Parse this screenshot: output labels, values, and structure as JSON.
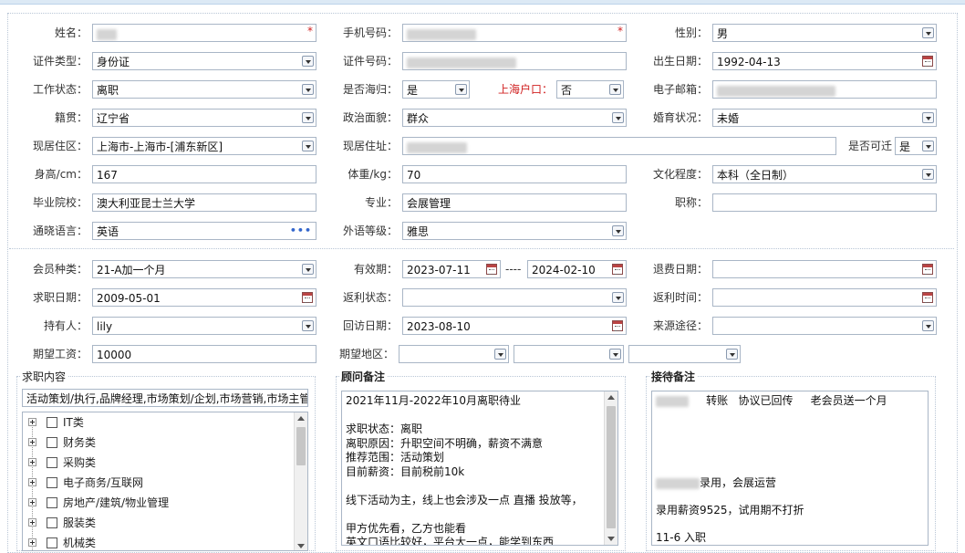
{
  "section1": {
    "row1": {
      "name_label": "姓名：",
      "phone_label": "手机号码：",
      "gender_label": "性别：",
      "gender_value": "男"
    },
    "row2": {
      "id_type_label": "证件类型：",
      "id_type_value": "身份证",
      "id_no_label": "证件号码：",
      "birth_label": "出生日期：",
      "birth_value": "1992-04-13"
    },
    "row3": {
      "work_status_label": "工作状态：",
      "work_status_value": "离职",
      "overseas_label": "是否海归：",
      "overseas_value": "是",
      "hukou_label": "上海户口：",
      "hukou_value": "否",
      "email_label": "电子邮箱："
    },
    "row4": {
      "native_label": "籍贯：",
      "native_value": "辽宁省",
      "political_label": "政治面貌：",
      "political_value": "群众",
      "marital_label": "婚育状况：",
      "marital_value": "未婚"
    },
    "row5": {
      "residence_label": "现居住区：",
      "residence_value": "上海市-上海市-[浦东新区]",
      "address_label": "现居住址：",
      "relocate_label": "是否可迁",
      "relocate_value": "是"
    },
    "row6": {
      "height_label": "身高/cm：",
      "height_value": "167",
      "weight_label": "体重/kg：",
      "weight_value": "70",
      "edu_label": "文化程度：",
      "edu_value": "本科（全日制）"
    },
    "row7": {
      "school_label": "毕业院校：",
      "school_value": "澳大利亚昆士兰大学",
      "major_label": "专业：",
      "major_value": "会展管理",
      "title_label": "职称：",
      "title_value": ""
    },
    "row8": {
      "lang_label": "通晓语言：",
      "lang_value": "英语",
      "lang_level_label": "外语等级：",
      "lang_level_value": "雅思"
    }
  },
  "section2": {
    "row1": {
      "member_type_label": "会员种类：",
      "member_type_value": "21-A加一个月",
      "valid_label": "有效期：",
      "valid_from": "2023-07-11",
      "valid_sep": "----",
      "valid_to": "2024-02-10",
      "refund_label": "退费日期："
    },
    "row2": {
      "job_date_label": "求职日期：",
      "job_date_value": "2009-05-01",
      "rebate_status_label": "返利状态：",
      "rebate_time_label": "返利时间："
    },
    "row3": {
      "holder_label": "持有人：",
      "holder_value": "lily",
      "visit_label": "回访日期：",
      "visit_value": "2023-08-10",
      "source_label": "来源途径："
    },
    "row4": {
      "salary_label": "期望工资：",
      "salary_value": "10000",
      "region_label": "期望地区："
    }
  },
  "job_content": {
    "title": "求职内容",
    "summary": "活动策划/执行,品牌经理,市场策划/企划,市场营销,市场主管",
    "tree": [
      {
        "label": "IT类"
      },
      {
        "label": "财务类"
      },
      {
        "label": "采购类"
      },
      {
        "label": "电子商务/互联网"
      },
      {
        "label": "房地产/建筑/物业管理"
      },
      {
        "label": "服装类"
      },
      {
        "label": "机械类"
      }
    ]
  },
  "advisor_notes": {
    "title": "顾问备注",
    "lines": [
      "2021年11月-2022年10月离职待业",
      "",
      "求职状态：离职",
      "离职原因：升职空间不明确，薪资不满意",
      "推荐范围：活动策划",
      "目前薪资：目前税前10k",
      "",
      "线下活动为主，线上也会涉及一点 直播 投放等，",
      "",
      "甲方优先看，乙方也能看",
      "英文口语比较好，平台大一点，能学到东西"
    ]
  },
  "reception_notes": {
    "title": "接待备注",
    "line1_a": "转账",
    "line1_b": "协议已回传",
    "line1_c": "老会员送一个月",
    "line2": "录用，会展运营",
    "line3": "录用薪资9525，试用期不打折",
    "line4": "11-6 入职"
  }
}
